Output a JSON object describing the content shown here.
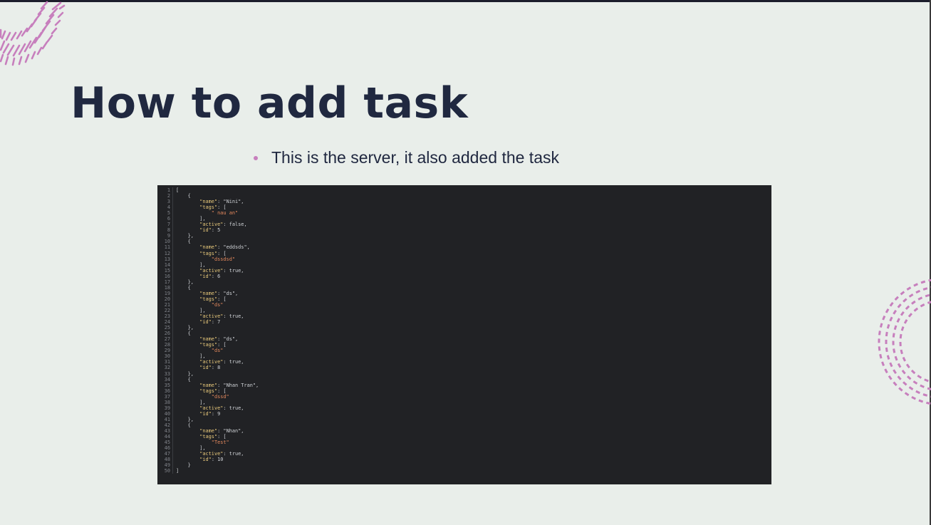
{
  "slide": {
    "title": "How to add task",
    "bullet": "This is the server, it also added the task",
    "accent_color": "#c77fbd",
    "title_color": "#202840",
    "background_color": "#e9eeea"
  },
  "code_panel": {
    "background_color": "#212225",
    "lines": [
      "[",
      "    {",
      "        \"name\": \"Nini\",",
      "        \"tags\": [",
      "            \" nau an\"",
      "        ],",
      "        \"active\": false,",
      "        \"id\": 5",
      "    },",
      "    {",
      "        \"name\": \"eddsds\",",
      "        \"tags\": [",
      "            \"dssdsd\"",
      "        ],",
      "        \"active\": true,",
      "        \"id\": 6",
      "    },",
      "    {",
      "        \"name\": \"ds\",",
      "        \"tags\": [",
      "            \"ds\"",
      "        ],",
      "        \"active\": true,",
      "        \"id\": 7",
      "    },",
      "    {",
      "        \"name\": \"ds\",",
      "        \"tags\": [",
      "            \"ds\"",
      "        ],",
      "        \"active\": true,",
      "        \"id\": 8",
      "    },",
      "    {",
      "        \"name\": \"Nhan Tran\",",
      "        \"tags\": [",
      "            \"dssd\"",
      "        ],",
      "        \"active\": true,",
      "        \"id\": 9",
      "    },",
      "    {",
      "        \"name\": \"Nhan\",",
      "        \"tags\": [",
      "            \"Test\"",
      "        ],",
      "        \"active\": true,",
      "        \"id\": 10",
      "    }",
      "]"
    ]
  }
}
